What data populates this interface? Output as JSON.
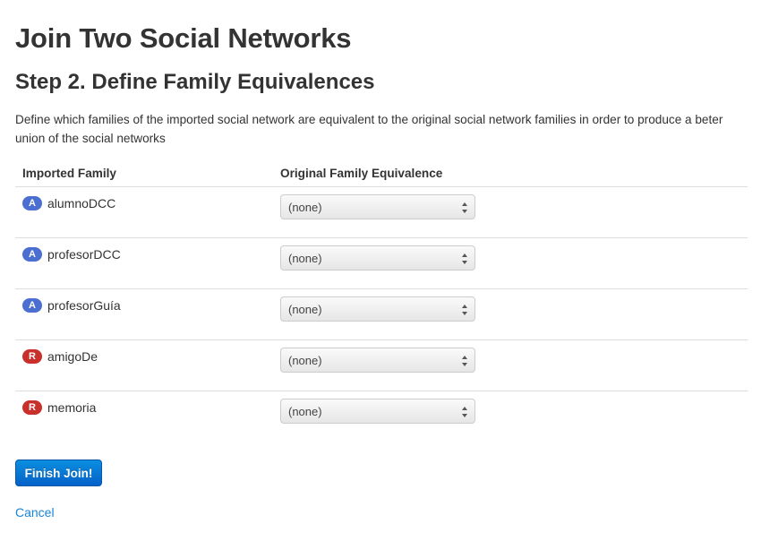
{
  "page": {
    "title": "Join Two Social Networks",
    "subtitle": "Step 2. Define Family Equivalences",
    "description": "Define which families of the imported social network are equivalent to the original social network families in order to produce a beter union of the social networks"
  },
  "table": {
    "headers": [
      "Imported Family",
      "Original Family Equivalence"
    ],
    "rows": [
      {
        "badge": "A",
        "badge_type": "attribute",
        "name": "alumnoDCC",
        "equivalence": "(none)"
      },
      {
        "badge": "A",
        "badge_type": "attribute",
        "name": "profesorDCC",
        "equivalence": "(none)"
      },
      {
        "badge": "A",
        "badge_type": "attribute",
        "name": "profesorGuía",
        "equivalence": "(none)"
      },
      {
        "badge": "R",
        "badge_type": "relation",
        "name": "amigoDe",
        "equivalence": "(none)"
      },
      {
        "badge": "R",
        "badge_type": "relation",
        "name": "memoria",
        "equivalence": "(none)"
      }
    ]
  },
  "actions": {
    "finish_label": "Finish Join!",
    "cancel_label": "Cancel"
  },
  "colors": {
    "attribute_badge": "#4a6fd1",
    "relation_badge": "#c9302c",
    "primary_button": "#0a73d8",
    "link": "#1a84d6"
  },
  "icons": {
    "select_arrows": "up-down-arrows-icon"
  }
}
